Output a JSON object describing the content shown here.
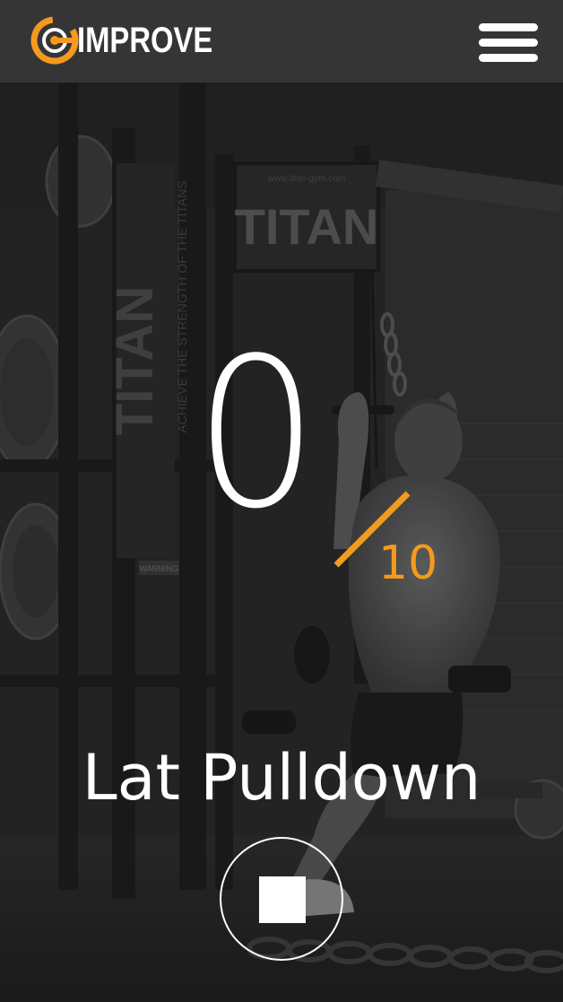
{
  "header": {
    "logo_text": "IMPROVE",
    "menu_icon": "hamburger-menu-icon"
  },
  "colors": {
    "accent": "#f39a1f",
    "header_bg": "#353535",
    "text": "#ffffff"
  },
  "background": {
    "sign_text": "TITAN",
    "sign_text_vertical": "TITAN",
    "tagline_vertical": "ACHIEVE THE STRENGTH OF THE TITANS",
    "small_sign": "www.titan-gym.com",
    "warning_label": "WARNING"
  },
  "counter": {
    "current": "0",
    "total": "10",
    "progress": 0
  },
  "exercise": {
    "name": "Lat Pulldown"
  },
  "controls": {
    "stop_icon": "stop-icon"
  }
}
